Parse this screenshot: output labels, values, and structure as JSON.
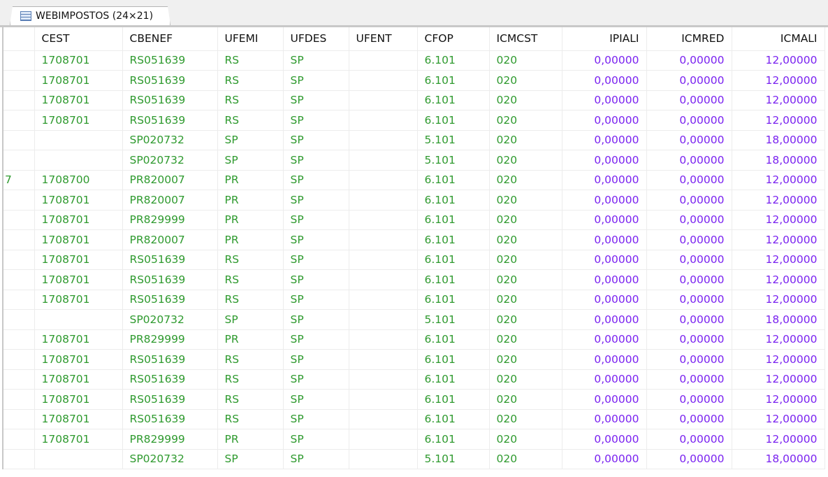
{
  "tab": {
    "title": "WEBIMPOSTOS (24×21)",
    "icon": "table-icon"
  },
  "columns": [
    "CEST",
    "CBENEF",
    "UFEMI",
    "UFDES",
    "UFENT",
    "CFOP",
    "ICMCST",
    "IPIALI",
    "ICMRED",
    "ICMALI"
  ],
  "rows": [
    [
      "",
      "1708701",
      "RS051639",
      "RS",
      "SP",
      "",
      "6.101",
      "020",
      "0,00000",
      "0,00000",
      "12,00000"
    ],
    [
      "",
      "1708701",
      "RS051639",
      "RS",
      "SP",
      "",
      "6.101",
      "020",
      "0,00000",
      "0,00000",
      "12,00000"
    ],
    [
      "",
      "1708701",
      "RS051639",
      "RS",
      "SP",
      "",
      "6.101",
      "020",
      "0,00000",
      "0,00000",
      "12,00000"
    ],
    [
      "",
      "1708701",
      "RS051639",
      "RS",
      "SP",
      "",
      "6.101",
      "020",
      "0,00000",
      "0,00000",
      "12,00000"
    ],
    [
      "",
      "",
      "SP020732",
      "SP",
      "SP",
      "",
      "5.101",
      "020",
      "0,00000",
      "0,00000",
      "18,00000"
    ],
    [
      "",
      "",
      "SP020732",
      "SP",
      "SP",
      "",
      "5.101",
      "020",
      "0,00000",
      "0,00000",
      "18,00000"
    ],
    [
      "7",
      "1708700",
      "PR820007",
      "PR",
      "SP",
      "",
      "6.101",
      "020",
      "0,00000",
      "0,00000",
      "12,00000"
    ],
    [
      "",
      "1708701",
      "PR820007",
      "PR",
      "SP",
      "",
      "6.101",
      "020",
      "0,00000",
      "0,00000",
      "12,00000"
    ],
    [
      "",
      "1708701",
      "PR829999",
      "PR",
      "SP",
      "",
      "6.101",
      "020",
      "0,00000",
      "0,00000",
      "12,00000"
    ],
    [
      "",
      "1708701",
      "PR820007",
      "PR",
      "SP",
      "",
      "6.101",
      "020",
      "0,00000",
      "0,00000",
      "12,00000"
    ],
    [
      "",
      "1708701",
      "RS051639",
      "RS",
      "SP",
      "",
      "6.101",
      "020",
      "0,00000",
      "0,00000",
      "12,00000"
    ],
    [
      "",
      "1708701",
      "RS051639",
      "RS",
      "SP",
      "",
      "6.101",
      "020",
      "0,00000",
      "0,00000",
      "12,00000"
    ],
    [
      "",
      "1708701",
      "RS051639",
      "RS",
      "SP",
      "",
      "6.101",
      "020",
      "0,00000",
      "0,00000",
      "12,00000"
    ],
    [
      "",
      "",
      "SP020732",
      "SP",
      "SP",
      "",
      "5.101",
      "020",
      "0,00000",
      "0,00000",
      "18,00000"
    ],
    [
      "",
      "1708701",
      "PR829999",
      "PR",
      "SP",
      "",
      "6.101",
      "020",
      "0,00000",
      "0,00000",
      "12,00000"
    ],
    [
      "",
      "1708701",
      "RS051639",
      "RS",
      "SP",
      "",
      "6.101",
      "020",
      "0,00000",
      "0,00000",
      "12,00000"
    ],
    [
      "",
      "1708701",
      "RS051639",
      "RS",
      "SP",
      "",
      "6.101",
      "020",
      "0,00000",
      "0,00000",
      "12,00000"
    ],
    [
      "",
      "1708701",
      "RS051639",
      "RS",
      "SP",
      "",
      "6.101",
      "020",
      "0,00000",
      "0,00000",
      "12,00000"
    ],
    [
      "",
      "1708701",
      "RS051639",
      "RS",
      "SP",
      "",
      "6.101",
      "020",
      "0,00000",
      "0,00000",
      "12,00000"
    ],
    [
      "",
      "1708701",
      "PR829999",
      "PR",
      "SP",
      "",
      "6.101",
      "020",
      "0,00000",
      "0,00000",
      "12,00000"
    ],
    [
      "",
      "",
      "SP020732",
      "SP",
      "SP",
      "",
      "5.101",
      "020",
      "0,00000",
      "0,00000",
      "18,00000"
    ]
  ],
  "colors": {
    "text": "#2f9a2f",
    "numeric": "#7a22f0"
  }
}
